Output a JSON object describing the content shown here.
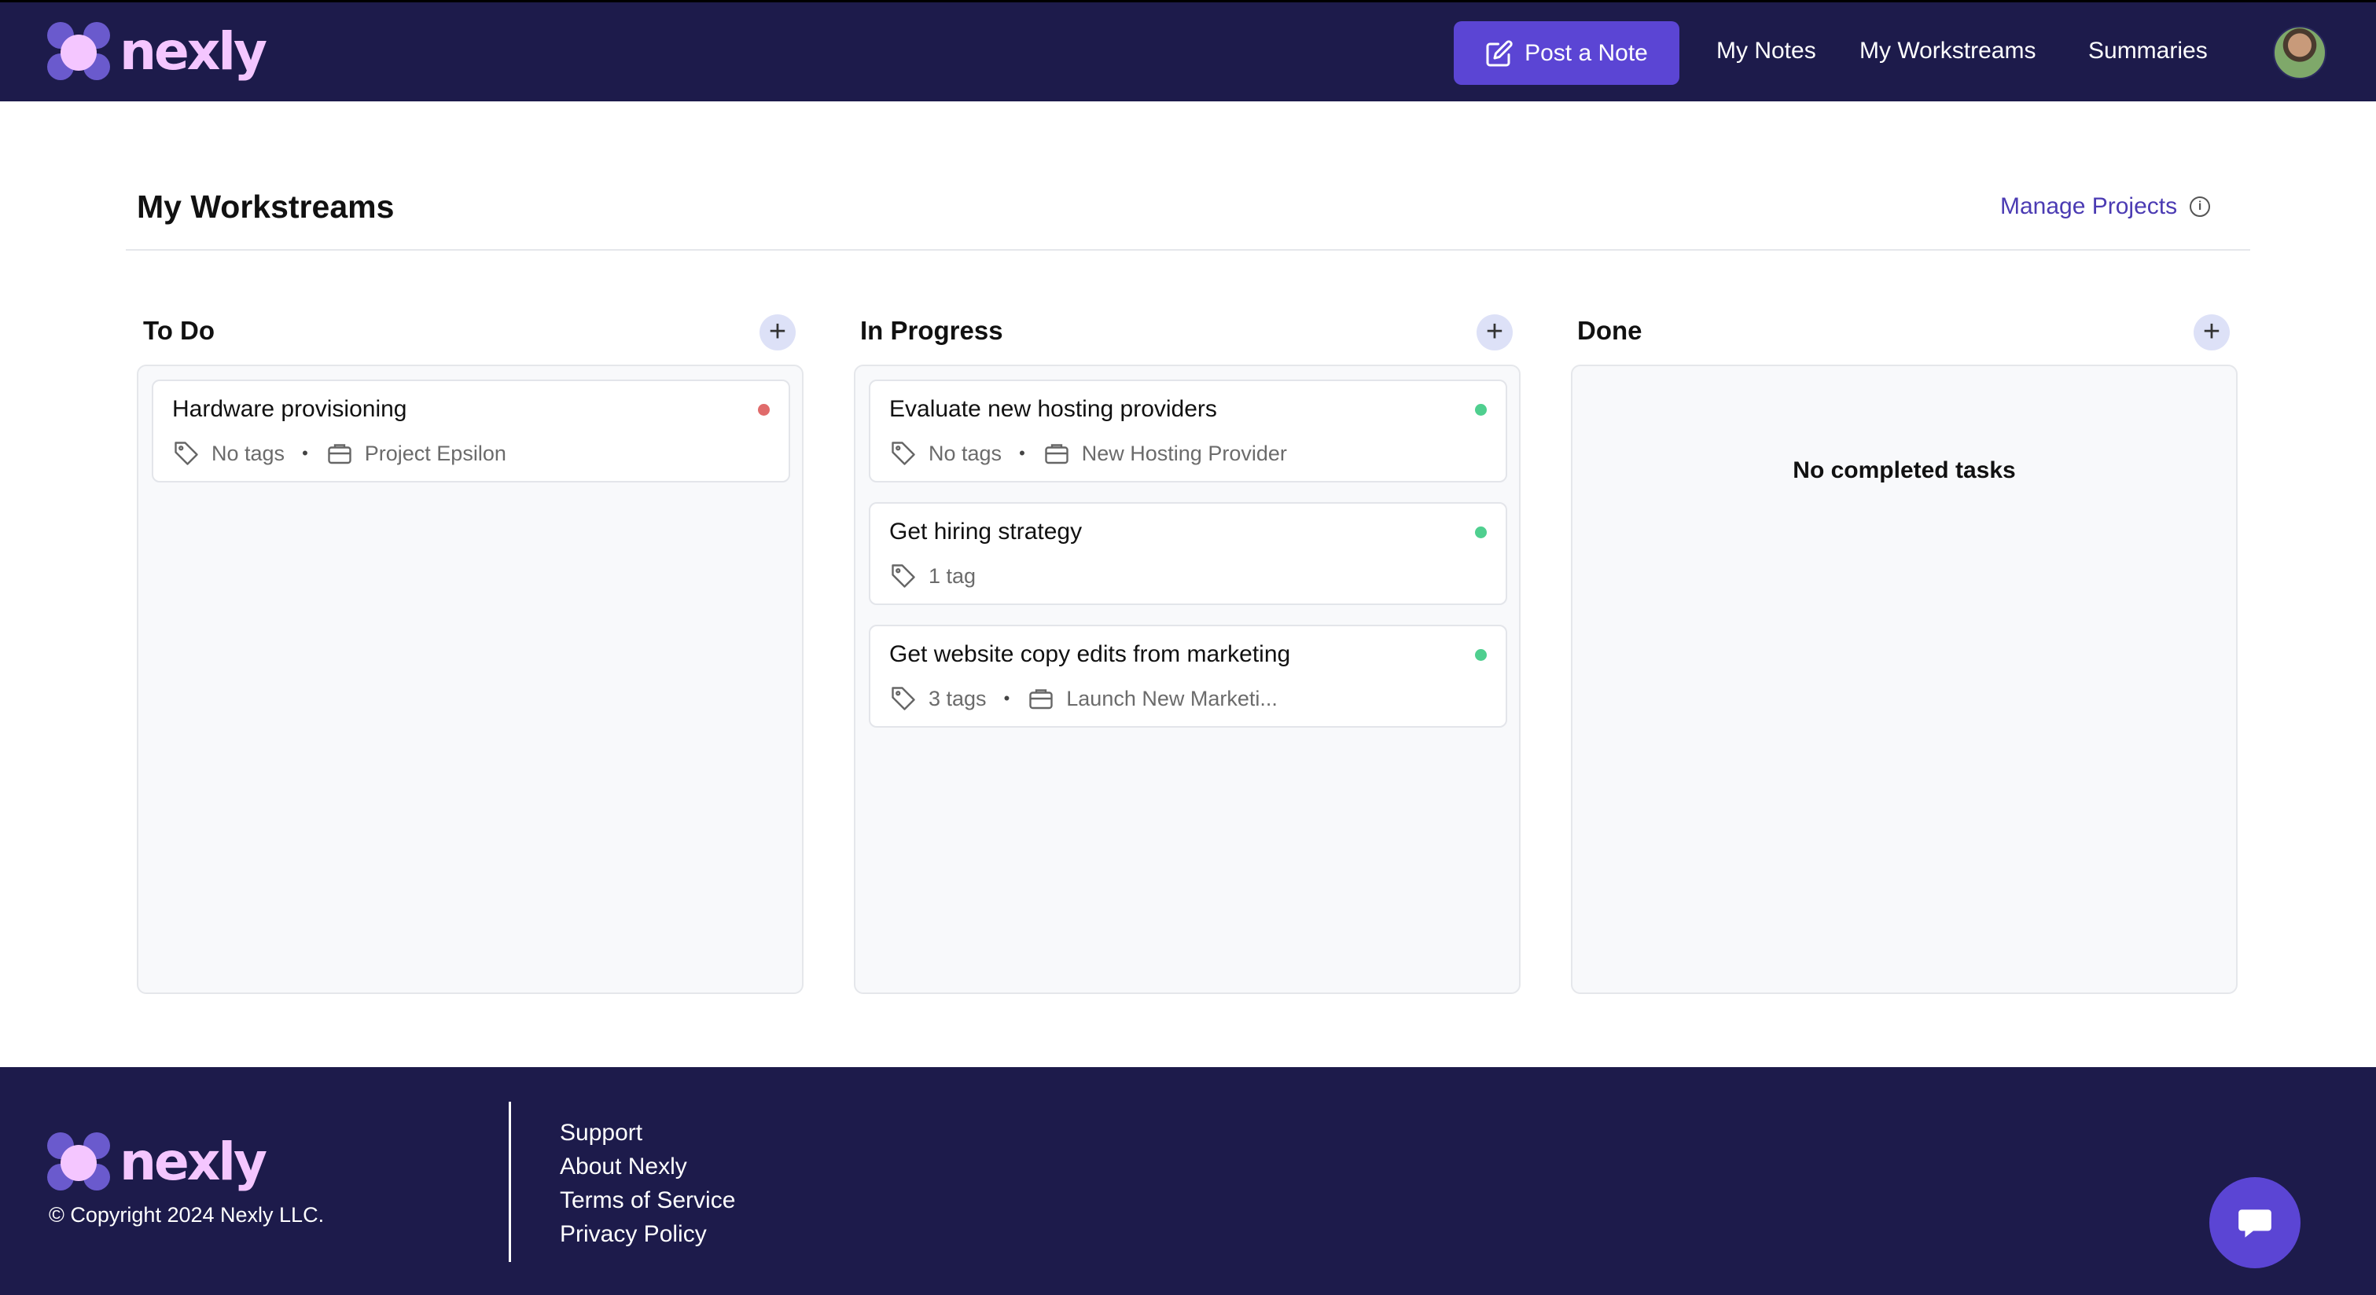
{
  "brand": {
    "name": "nexly"
  },
  "header": {
    "post_note_label": "Post a Note",
    "nav": [
      {
        "label": "My Notes"
      },
      {
        "label": "My Workstreams"
      },
      {
        "label": "Summaries"
      }
    ]
  },
  "page": {
    "title": "My Workstreams",
    "manage_projects_label": "Manage Projects"
  },
  "columns": [
    {
      "title": "To Do",
      "cards": [
        {
          "title": "Hardware provisioning",
          "tags": "No tags",
          "project": "Project Epsilon",
          "status_color": "#e06b6b"
        }
      ]
    },
    {
      "title": "In Progress",
      "cards": [
        {
          "title": "Evaluate new hosting providers",
          "tags": "No tags",
          "project": "New Hosting Provider",
          "status_color": "#4fcf8f"
        },
        {
          "title": "Get hiring strategy",
          "tags": "1 tag",
          "project": "",
          "status_color": "#4fcf8f"
        },
        {
          "title": "Get website copy edits from marketing",
          "tags": "3 tags",
          "project": "Launch New Marketi...",
          "status_color": "#4fcf8f"
        }
      ]
    },
    {
      "title": "Done",
      "cards": [],
      "empty_message": "No completed tasks"
    }
  ],
  "footer": {
    "copyright": "© Copyright 2024 Nexly LLC.",
    "links": [
      "Support",
      "About Nexly",
      "Terms of Service",
      "Privacy Policy"
    ]
  },
  "colors": {
    "navy": "#1d1b4b",
    "accent": "#5b45d4",
    "link": "#4b3bb3",
    "status_red": "#e06b6b",
    "status_green": "#4fcf8f"
  },
  "icons": [
    "edit-icon",
    "info-icon",
    "plus-icon",
    "tag-icon",
    "briefcase-icon",
    "chat-bubble-icon"
  ]
}
